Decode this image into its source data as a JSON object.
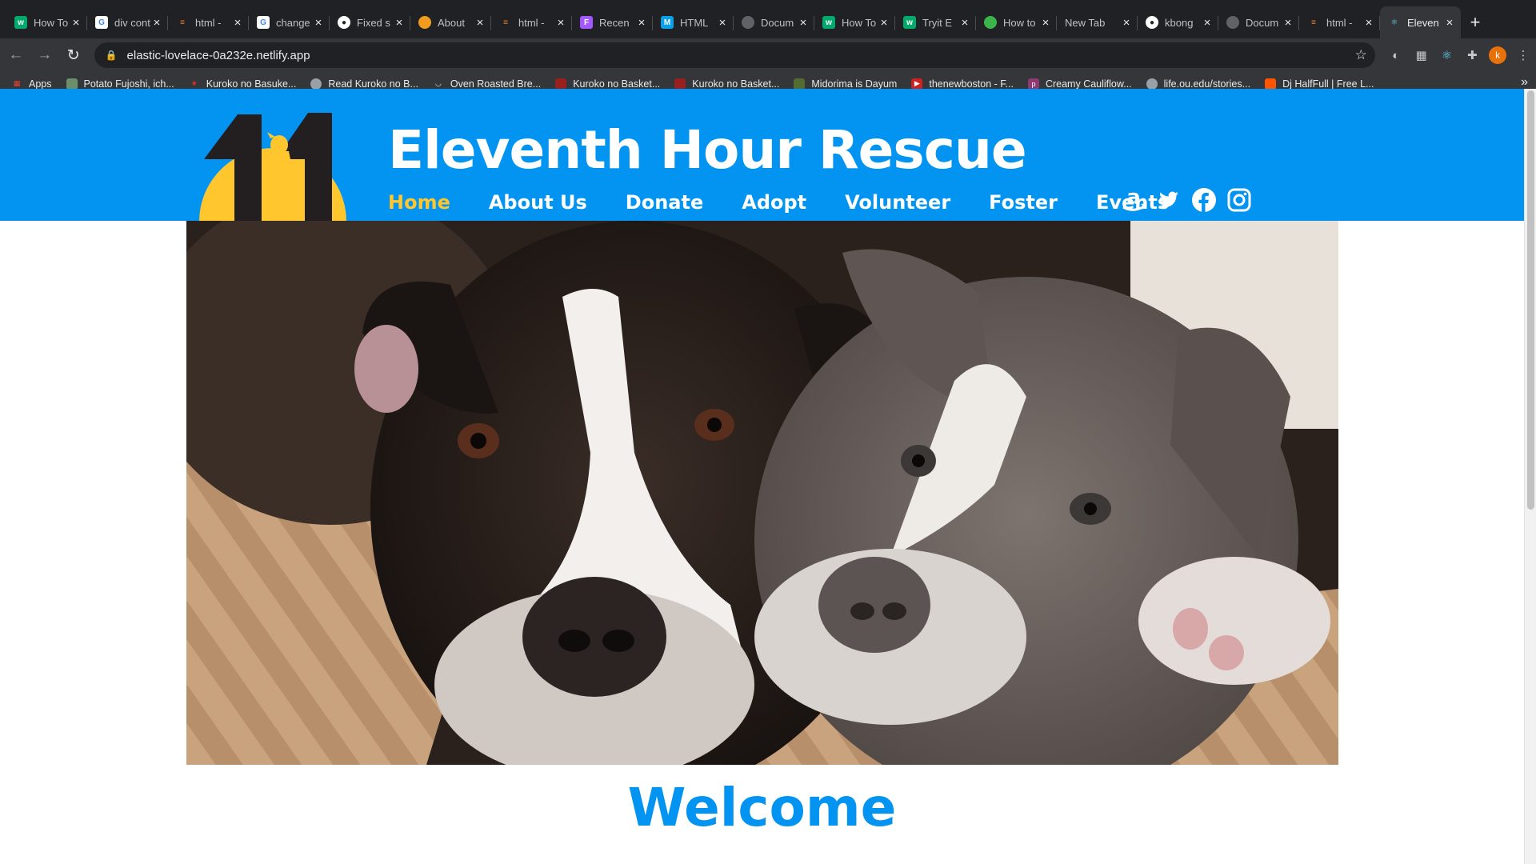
{
  "browser": {
    "tabs": [
      {
        "title": "How To",
        "favicon": "w3schools-icon",
        "color": "#04aa6d"
      },
      {
        "title": "div cont",
        "favicon": "google-icon",
        "color": "#ffffff"
      },
      {
        "title": "html - ",
        "favicon": "stackoverflow-icon",
        "color": "#f48024"
      },
      {
        "title": "change",
        "favicon": "google-icon",
        "color": "#ffffff"
      },
      {
        "title": "Fixed s",
        "favicon": "github-icon",
        "color": "#ffffff"
      },
      {
        "title": "About",
        "favicon": "site-icon",
        "color": "#f29c1f"
      },
      {
        "title": "html - ",
        "favicon": "stackoverflow-icon",
        "color": "#f48024"
      },
      {
        "title": "Recen",
        "favicon": "figma-icon",
        "color": "#a259ff"
      },
      {
        "title": "HTML",
        "favicon": "m-icon",
        "color": "#0aa0e8"
      },
      {
        "title": "Docum",
        "favicon": "globe-icon",
        "color": "#5f6368"
      },
      {
        "title": "How To",
        "favicon": "w3schools-icon",
        "color": "#04aa6d"
      },
      {
        "title": "Tryit E",
        "favicon": "w3schools-icon",
        "color": "#04aa6d"
      },
      {
        "title": "How to",
        "favicon": "site-icon",
        "color": "#3bb54a"
      },
      {
        "title": "New Tab",
        "favicon": "",
        "color": ""
      },
      {
        "title": "kbong",
        "favicon": "github-icon",
        "color": "#ffffff"
      },
      {
        "title": "Docum",
        "favicon": "globe-icon",
        "color": "#5f6368"
      },
      {
        "title": "html - ",
        "favicon": "stackoverflow-icon",
        "color": "#f48024"
      },
      {
        "title": "Eleven",
        "favicon": "react-icon",
        "color": "#61dafb",
        "active": true
      }
    ],
    "url": "elastic-lovelace-0a232e.netlify.app",
    "profile_initial": "k",
    "bookmarks": [
      {
        "label": "Apps",
        "icon": "apps-grid-icon",
        "color": "#ea4335"
      },
      {
        "label": "Potato Fujoshi, ich...",
        "icon": "bookmark-image-icon",
        "color": "#6b8e6b"
      },
      {
        "label": "Kuroko no Basuke...",
        "icon": "star-icon",
        "color": "#d93025"
      },
      {
        "label": "Read Kuroko no B...",
        "icon": "globe-icon",
        "color": "#9aa0a6"
      },
      {
        "label": "Oven Roasted Bre...",
        "icon": "bowl-icon",
        "color": "#9aa0a6"
      },
      {
        "label": "Kuroko no Basket...",
        "icon": "ao3-icon",
        "color": "#9a1f1f"
      },
      {
        "label": "Kuroko no Basket...",
        "icon": "ao3-icon",
        "color": "#9a1f1f"
      },
      {
        "label": "Midorima is Dayum",
        "icon": "bookmark-image-icon",
        "color": "#556b2f"
      },
      {
        "label": "thenewboston - F...",
        "icon": "play-icon",
        "color": "#cc2222"
      },
      {
        "label": "Creamy Cauliflow...",
        "icon": "p-icon",
        "color": "#8e3a70"
      },
      {
        "label": "life.ou.edu/stories...",
        "icon": "globe-icon",
        "color": "#9aa0a6"
      },
      {
        "label": "Dj HalfFull | Free L...",
        "icon": "soundcloud-icon",
        "color": "#ff5500"
      }
    ]
  },
  "site": {
    "logo_text": "11",
    "title": "Eleventh Hour Rescue",
    "nav": [
      {
        "label": "Home",
        "current": true
      },
      {
        "label": "About Us"
      },
      {
        "label": "Donate"
      },
      {
        "label": "Adopt"
      },
      {
        "label": "Volunteer"
      },
      {
        "label": "Foster"
      },
      {
        "label": "Events"
      }
    ],
    "social": [
      "amazon-icon",
      "twitter-icon",
      "facebook-icon",
      "instagram-icon"
    ],
    "hero_image": "two-pit-bull-dogs-lying-on-bed-photo",
    "welcome": "Welcome",
    "colors": {
      "header_blue": "#0394f2",
      "active_nav": "#ffc62d",
      "logo_sun": "#ffc62d",
      "logo_dark": "#231f20"
    }
  }
}
